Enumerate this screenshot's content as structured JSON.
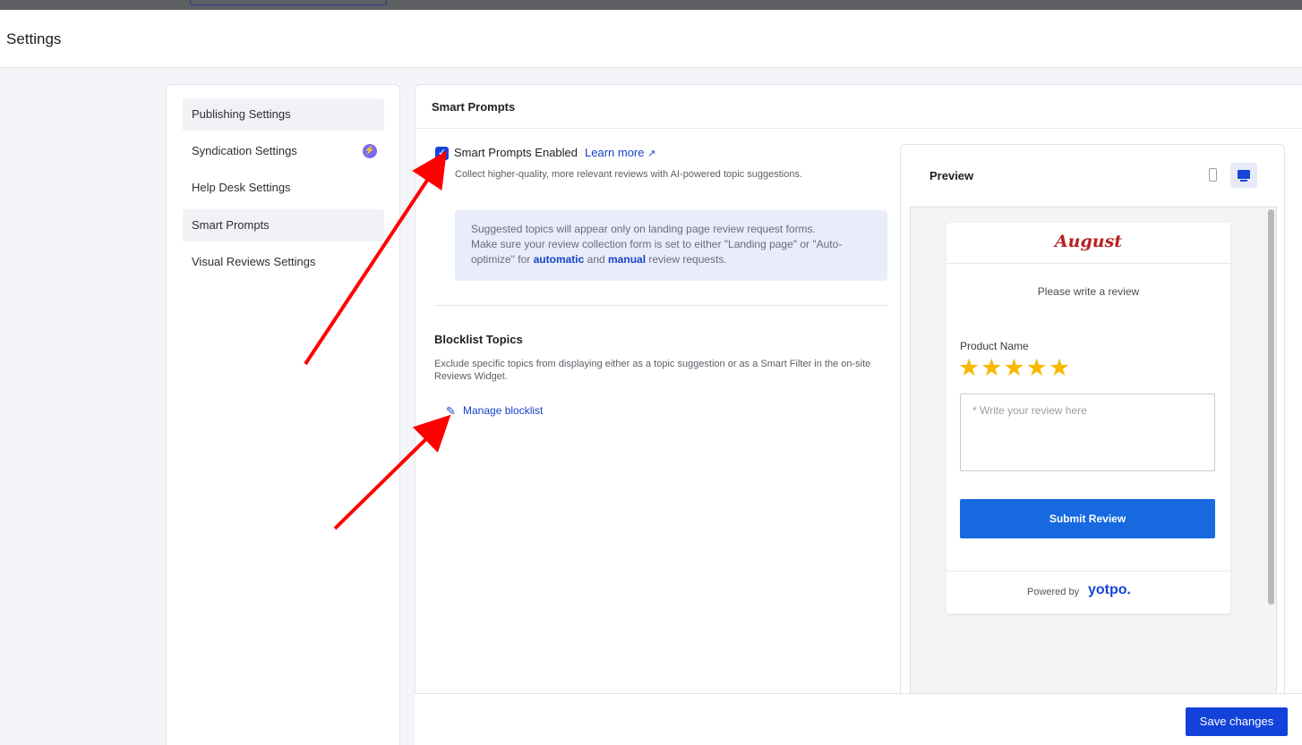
{
  "header": {
    "title": "Settings"
  },
  "sidebar": {
    "items": [
      {
        "label": "Publishing Settings",
        "active": true
      },
      {
        "label": "Syndication Settings",
        "badge_icon": "lightning-icon"
      },
      {
        "label": "Help Desk Settings"
      },
      {
        "label": "Smart Prompts",
        "active": true
      },
      {
        "label": "Visual Reviews Settings"
      }
    ]
  },
  "main": {
    "title": "Smart Prompts",
    "enable": {
      "label": "Smart Prompts Enabled",
      "checked": true,
      "learn_more": "Learn more",
      "description": "Collect higher-quality, more relevant reviews with AI-powered topic suggestions."
    },
    "info": {
      "line1": "Suggested topics will appear only on landing page review request forms.",
      "line2_pre": "Make sure your review collection form is set to either \"Landing page\" or \"Auto-optimize\" for ",
      "automatic": "automatic",
      "and": " and ",
      "manual": "manual",
      "line2_post": " review requests."
    },
    "blocklist": {
      "title": "Blocklist Topics",
      "description": "Exclude specific topics from displaying either as a topic suggestion or as a Smart Filter in the on-site Reviews Widget.",
      "manage_label": "Manage blocklist"
    }
  },
  "preview": {
    "title": "Preview",
    "brand": "August",
    "prompt": "Please write a review",
    "product_name": "Product Name",
    "stars": "★★★★★",
    "rating": 5,
    "review_placeholder": "* Write your review here",
    "submit_label": "Submit Review",
    "powered_by": "Powered by",
    "powered_brand": "yotpo."
  },
  "footer": {
    "save_label": "Save changes"
  },
  "colors": {
    "accent": "#1342db",
    "star": "#f7b800",
    "brand_red": "#b82121",
    "annotation_arrow": "#ff0000"
  }
}
